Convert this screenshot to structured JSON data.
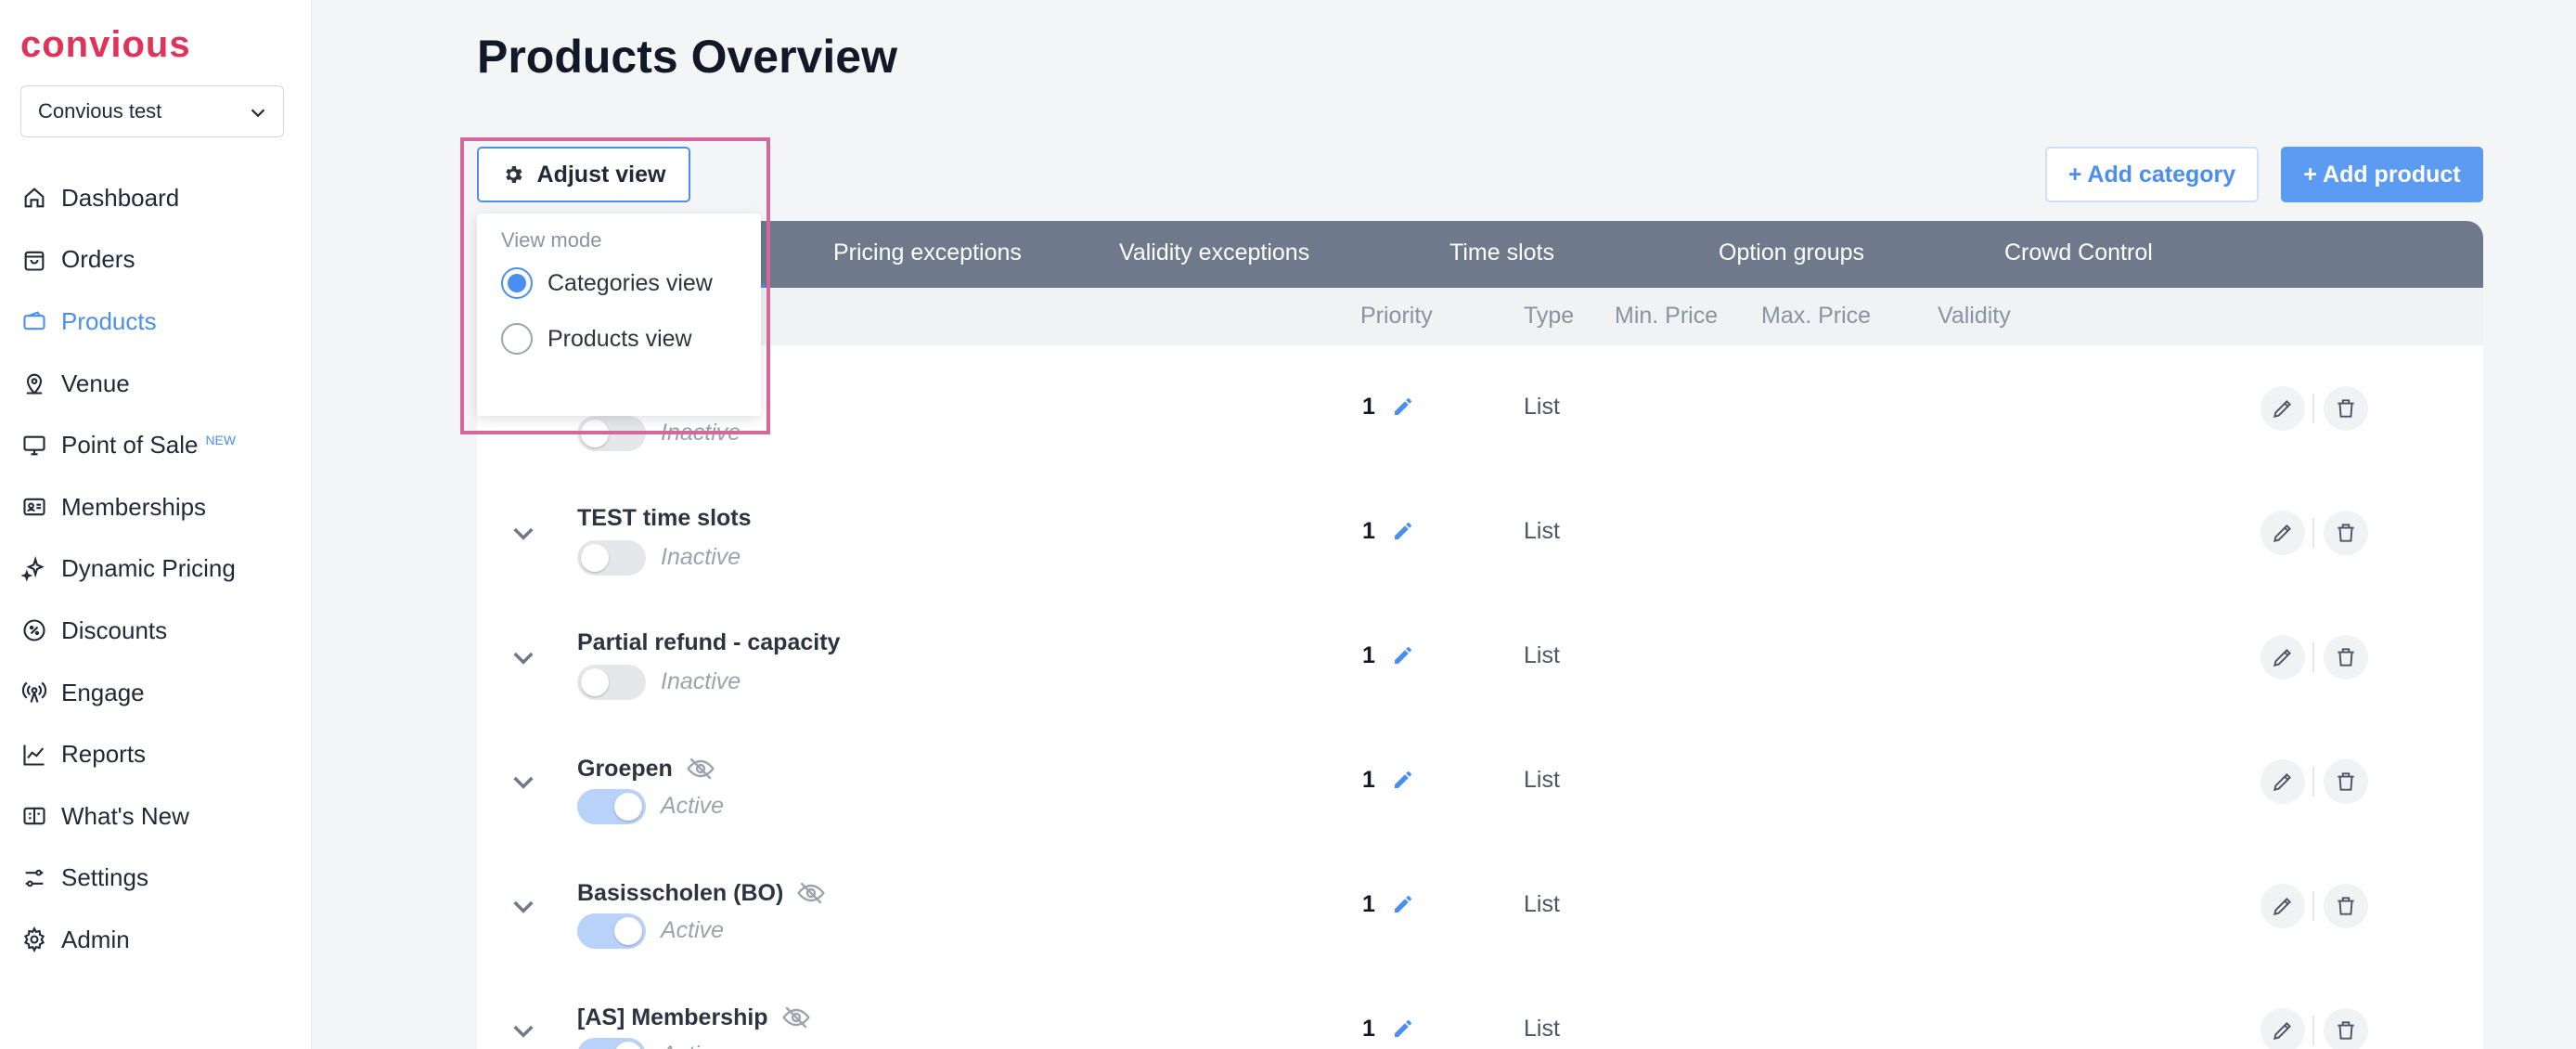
{
  "brand": {
    "logo_text": "convious",
    "accent": "#e0335a",
    "link": "#4a8ef0"
  },
  "account": {
    "name": "Convious test"
  },
  "sidebar": {
    "items": [
      {
        "label": "Dashboard",
        "icon": "home-icon",
        "active": false
      },
      {
        "label": "Orders",
        "icon": "shopping-bag-icon",
        "active": false
      },
      {
        "label": "Products",
        "icon": "ticket-icon",
        "active": true
      },
      {
        "label": "Venue",
        "icon": "location-pin-icon",
        "active": false
      },
      {
        "label": "Point of Sale",
        "icon": "monitor-icon",
        "active": false,
        "badge": "NEW"
      },
      {
        "label": "Memberships",
        "icon": "id-card-icon",
        "active": false
      },
      {
        "label": "Dynamic Pricing",
        "icon": "sparkle-icon",
        "active": false
      },
      {
        "label": "Discounts",
        "icon": "discount-badge-icon",
        "active": false
      },
      {
        "label": "Engage",
        "icon": "broadcast-icon",
        "active": false
      },
      {
        "label": "Reports",
        "icon": "line-chart-icon",
        "active": false
      },
      {
        "label": "What's New",
        "icon": "whats-new-icon",
        "active": false
      },
      {
        "label": "Settings",
        "icon": "sliders-icon",
        "active": false
      },
      {
        "label": "Admin",
        "icon": "gear-icon",
        "active": false
      }
    ]
  },
  "header": {
    "title": "Products Overview"
  },
  "toolbar": {
    "adjust_view_label": "Adjust view",
    "add_category_label": "+ Add category",
    "add_product_label": "+ Add product"
  },
  "view_menu": {
    "label": "View mode",
    "options": [
      {
        "label": "Categories view",
        "selected": true
      },
      {
        "label": "Products view",
        "selected": false
      }
    ]
  },
  "tabs": [
    "Pricing exceptions",
    "Validity exceptions",
    "Time slots",
    "Option groups",
    "Crowd Control"
  ],
  "columns": [
    "Priority",
    "Type",
    "Min. Price",
    "Max. Price",
    "Validity"
  ],
  "rows": [
    {
      "name": "",
      "status": "Inactive",
      "active": false,
      "hidden": false,
      "priority": "1",
      "type": "List"
    },
    {
      "name": "TEST time slots",
      "status": "Inactive",
      "active": false,
      "hidden": false,
      "priority": "1",
      "type": "List"
    },
    {
      "name": "Partial refund - capacity",
      "status": "Inactive",
      "active": false,
      "hidden": false,
      "priority": "1",
      "type": "List"
    },
    {
      "name": "Groepen",
      "status": "Active",
      "active": true,
      "hidden": true,
      "priority": "1",
      "type": "List"
    },
    {
      "name": "Basisscholen (BO)",
      "status": "Active",
      "active": true,
      "hidden": true,
      "priority": "1",
      "type": "List"
    },
    {
      "name": "[AS] Membership",
      "status": "Active",
      "active": true,
      "hidden": true,
      "priority": "1",
      "type": "List"
    }
  ]
}
